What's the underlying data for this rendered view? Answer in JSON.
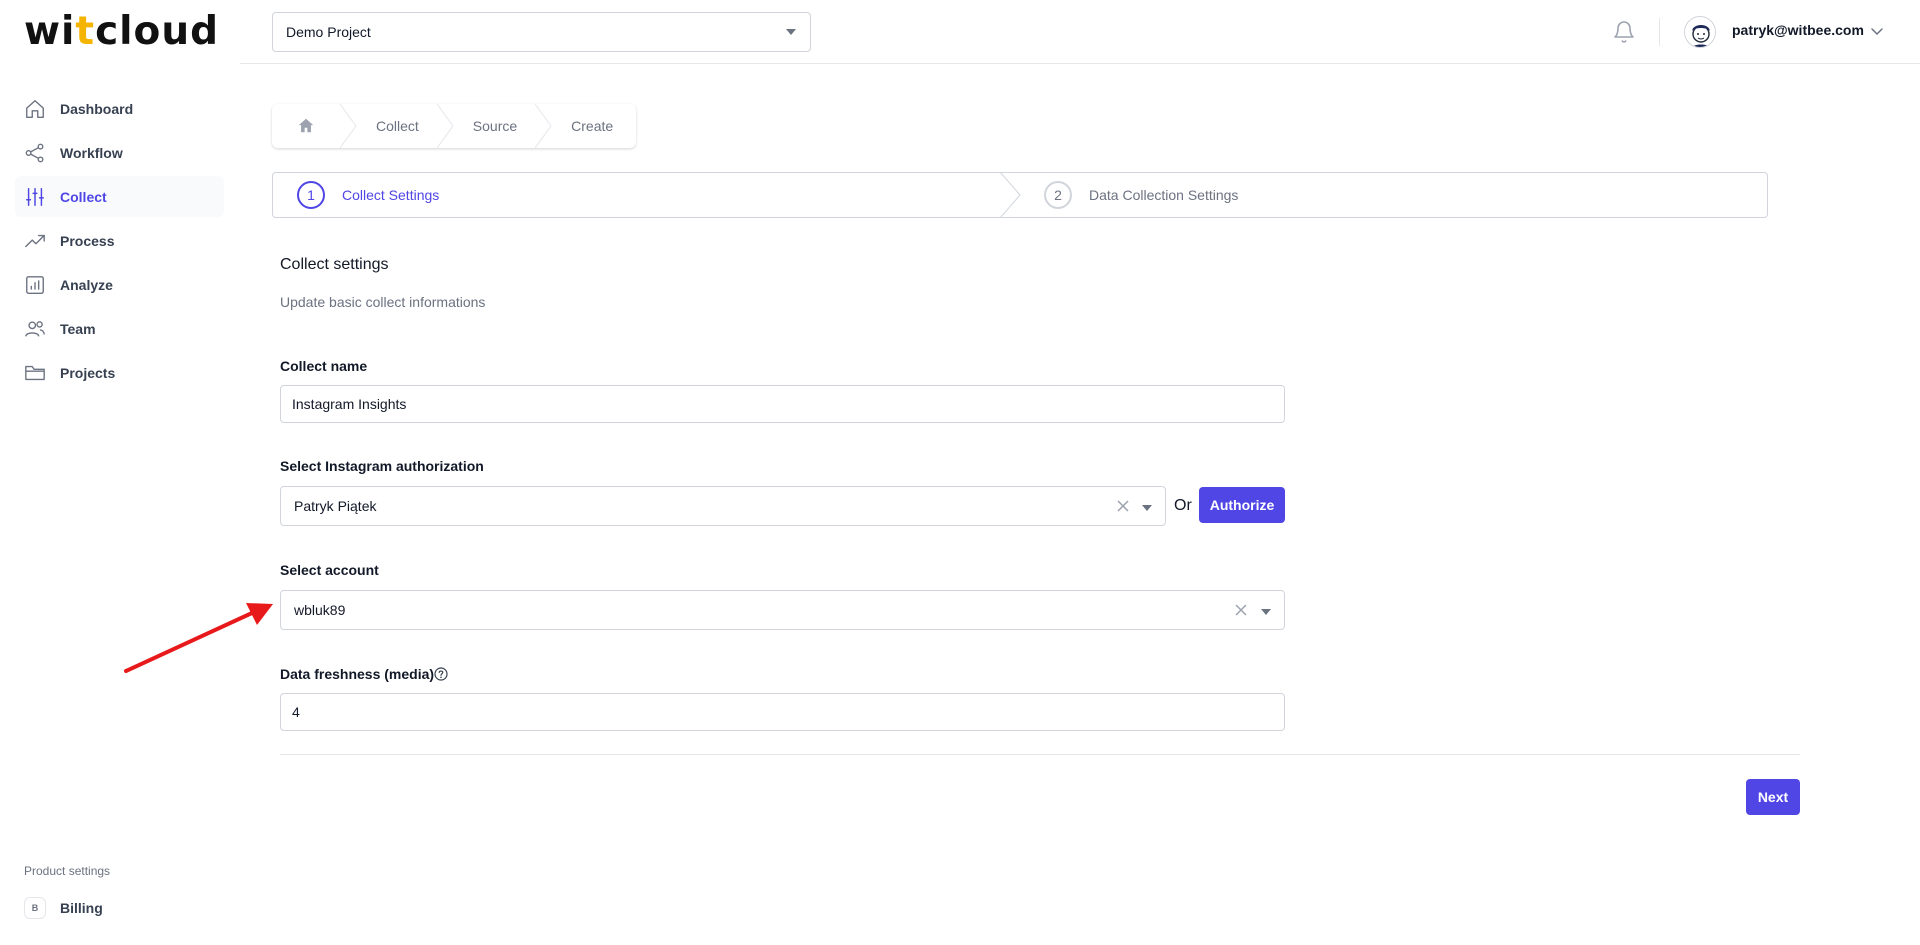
{
  "header": {
    "logo_prefix": "wi",
    "logo_accent": "t",
    "logo_suffix": "cloud",
    "project_select_value": "Demo Project",
    "user_email": "patryk@witbee.com"
  },
  "sidebar": {
    "items": [
      {
        "label": "Dashboard",
        "icon": "home-icon",
        "active": false
      },
      {
        "label": "Workflow",
        "icon": "share-icon",
        "active": false
      },
      {
        "label": "Collect",
        "icon": "sliders-icon",
        "active": true
      },
      {
        "label": "Process",
        "icon": "trending-up-icon",
        "active": false
      },
      {
        "label": "Analyze",
        "icon": "bar-chart-icon",
        "active": false
      },
      {
        "label": "Team",
        "icon": "users-icon",
        "active": false
      },
      {
        "label": "Projects",
        "icon": "folder-icon",
        "active": false
      }
    ],
    "footer_label": "Product settings",
    "billing_badge": "B",
    "billing_label": "Billing"
  },
  "breadcrumb": {
    "items": [
      "Collect",
      "Source",
      "Create"
    ]
  },
  "steps": [
    {
      "number": "1",
      "label": "Collect Settings",
      "state": "current"
    },
    {
      "number": "2",
      "label": "Data Collection Settings",
      "state": "upcoming"
    }
  ],
  "form": {
    "title": "Collect settings",
    "subtitle": "Update basic collect informations",
    "collect_name_label": "Collect name",
    "collect_name_value": "Instagram Insights",
    "authorization_label": "Select Instagram authorization",
    "authorization_value": "Patryk Piątek",
    "or_text": "Or",
    "authorize_button": "Authorize",
    "account_label": "Select account",
    "account_value": "wbluk89",
    "freshness_label": "Data freshness (media)",
    "freshness_value": "4",
    "next_button": "Next"
  },
  "colors": {
    "accent": "#4f46e5",
    "logo_accent": "#f5b400",
    "annotation_arrow": "#e8191b"
  }
}
